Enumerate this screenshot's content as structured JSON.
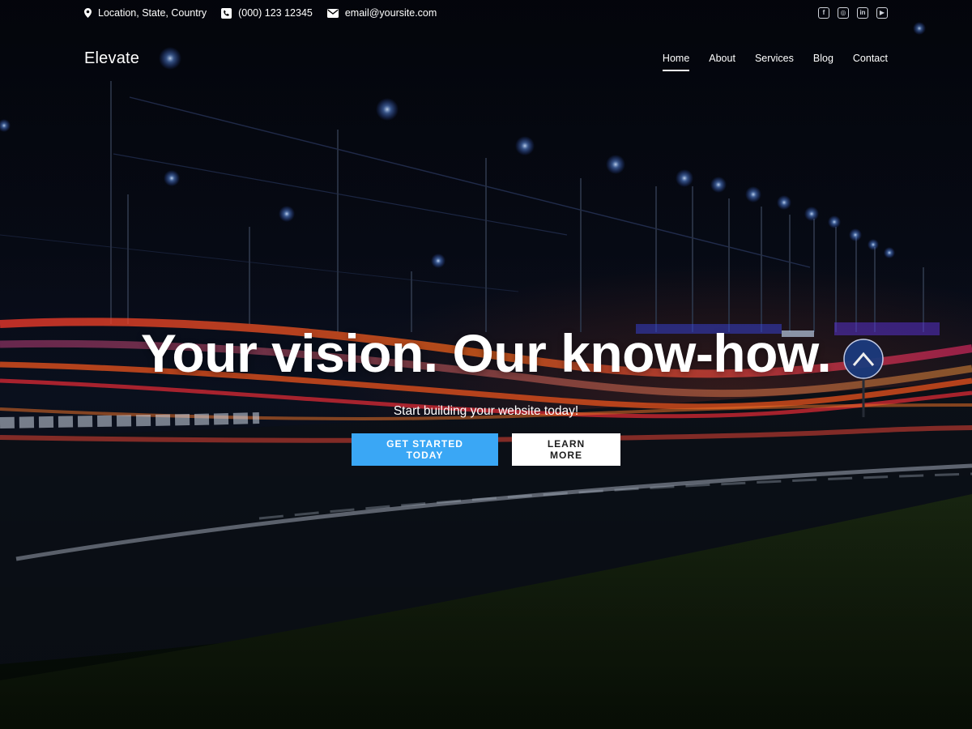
{
  "topbar": {
    "location": "Location, State, Country",
    "phone": "(000) 123 12345",
    "email": "email@yoursite.com",
    "social": [
      {
        "name": "facebook-icon",
        "glyph": "f"
      },
      {
        "name": "instagram-icon",
        "glyph": "◎"
      },
      {
        "name": "linkedin-icon",
        "glyph": "in"
      },
      {
        "name": "youtube-icon",
        "glyph": "▶"
      }
    ]
  },
  "header": {
    "site_title": "Elevate",
    "nav": [
      {
        "label": "Home",
        "active": true
      },
      {
        "label": "About",
        "active": false
      },
      {
        "label": "Services",
        "active": false
      },
      {
        "label": "Blog",
        "active": false
      },
      {
        "label": "Contact",
        "active": false
      }
    ]
  },
  "hero": {
    "title": "Your vision. Our know-how.",
    "subtitle": "Start building your website today!",
    "primary_button": "GET STARTED TODAY",
    "secondary_button": "LEARN MORE"
  },
  "colors": {
    "accent": "#3aa7f5",
    "button_secondary_bg": "#ffffff"
  }
}
